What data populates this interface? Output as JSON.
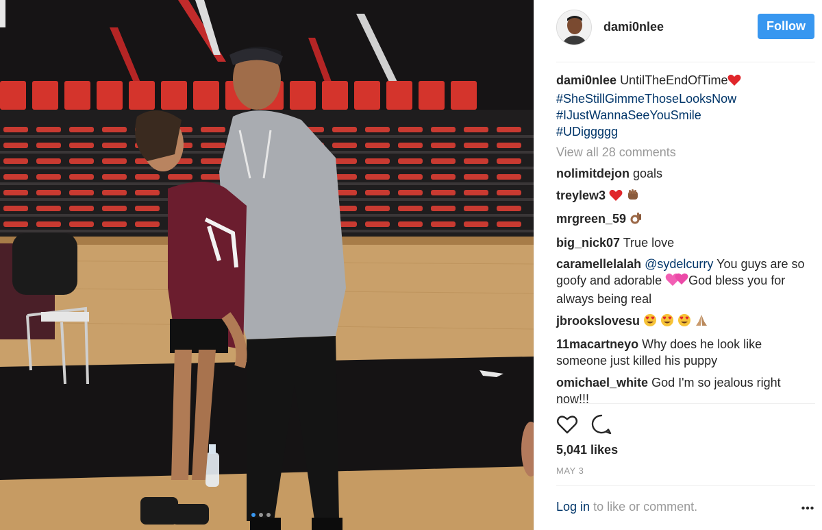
{
  "post": {
    "username": "dami0nlee",
    "follow_label": "Follow",
    "caption_text": "UntilTheEndOfTime",
    "hashtags": [
      "#SheStillGimmeThoseLooksNow",
      "#IJustWannaSeeYouSmile",
      "#UDiggggg"
    ],
    "view_all": "View all 28 comments",
    "comments": [
      {
        "user": "nolimitdejon",
        "text": "goals"
      },
      {
        "user": "treylew3",
        "text": ""
      },
      {
        "user": "mrgreen_59",
        "text": ""
      },
      {
        "user": "big_nick07",
        "text": "True love"
      },
      {
        "user": "caramellelalah",
        "mention": "@sydelcurry",
        "text": "You guys are so goofy and adorable",
        "text2": "God bless you for always being real"
      },
      {
        "user": "jbrookslovesu",
        "text": ""
      },
      {
        "user": "11macartneyo",
        "text": "Why does he look like someone just killed his puppy"
      },
      {
        "user": "omichael_white",
        "text": "God I'm so jealous right now!!!"
      }
    ],
    "likes": "5,041 likes",
    "date": "MAY 3",
    "login_link": "Log in",
    "login_text": "to like or comment.",
    "carousel_index": 1,
    "carousel_total": 3,
    "icons": [
      "heart-icon",
      "comment-icon",
      "more-options-icon",
      "red-heart-emoji",
      "two-hearts-emoji",
      "raised-fist-emoji",
      "ok-hand-emoji",
      "heart-eyes-emoji",
      "praying-hands-emoji"
    ],
    "colors": {
      "accent": "#3897f0",
      "link": "#003569",
      "muted": "#999999",
      "seat_red": "#d4342c",
      "jersey_maroon": "#6b1d2e"
    }
  }
}
